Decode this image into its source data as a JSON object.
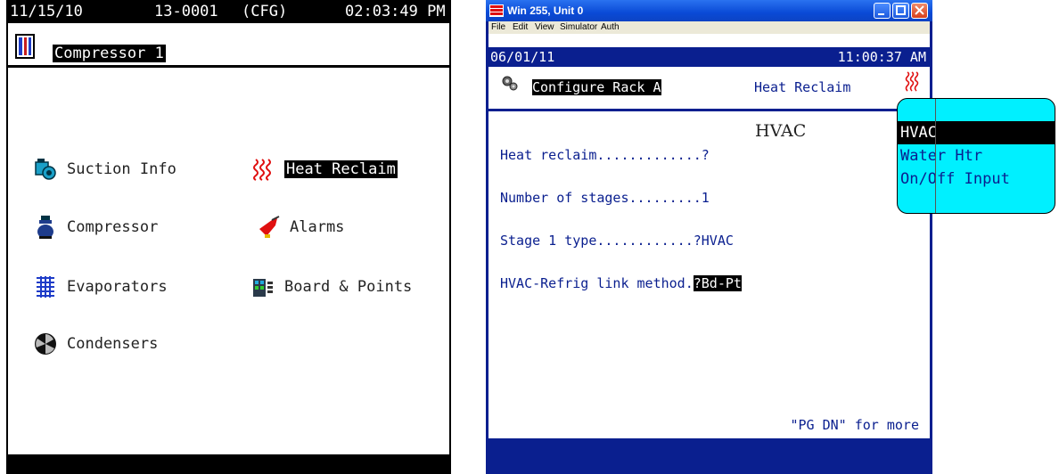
{
  "left_panel": {
    "date": "11/15/10",
    "controller_id": "13-0001",
    "mode": "(CFG)",
    "time": "02:03:49 PM",
    "title": "Compressor 1",
    "menu": [
      {
        "label": "Suction Info",
        "icon": "suction-icon"
      },
      {
        "label": "Heat Reclaim",
        "icon": "heat-reclaim-icon",
        "highlighted": true
      },
      {
        "label": "Compressor",
        "icon": "compressor-icon"
      },
      {
        "label": "Alarms",
        "icon": "alarm-icon"
      },
      {
        "label": "Evaporators",
        "icon": "evaporator-icon"
      },
      {
        "label": "Board & Points",
        "icon": "board-icon"
      },
      {
        "label": "Condensers",
        "icon": "condenser-fan-icon"
      }
    ]
  },
  "window": {
    "title": "Win 255, Unit 0",
    "menu": [
      "File",
      "Edit",
      "View",
      "Simulator",
      "Auth"
    ],
    "date": "06/01/11",
    "time": "11:00:37 AM",
    "screen_title": "Configure Rack A",
    "section": "Heat Reclaim",
    "form": [
      {
        "label": "Heat reclaim.............",
        "value": "?"
      },
      {
        "label": "Number of stages.........",
        "value": "1"
      },
      {
        "label": "Stage 1 type............",
        "value": "?HVAC"
      },
      {
        "label": "HVAC-Refrig link method.",
        "value": "?Bd-Pt"
      }
    ],
    "overlay_value": "HVAC",
    "footer": "\"PG DN\" for more"
  },
  "dropdown": {
    "options": [
      "HVAC",
      "Water Htr",
      "On/Off Input"
    ],
    "selected": "HVAC"
  },
  "colors": {
    "window_blue": "#0a1f8f",
    "popup_cyan": "#00f0ff"
  }
}
